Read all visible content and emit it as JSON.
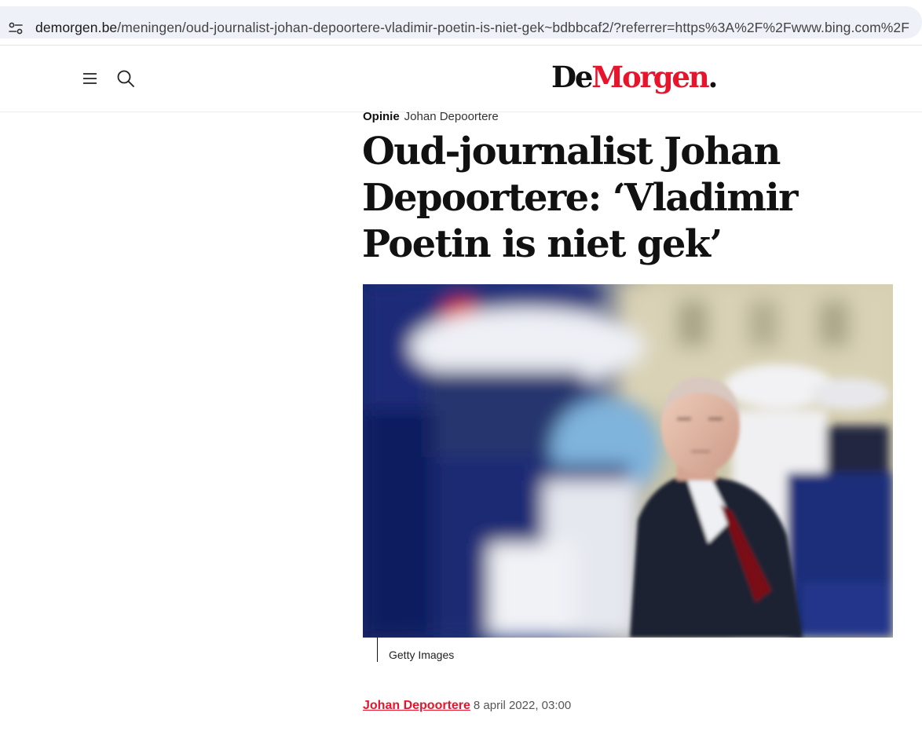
{
  "browser": {
    "url_host": "demorgen.be",
    "url_path": "/meningen/oud-journalist-johan-depoortere-vladimir-poetin-is-niet-gek~bdbbcaf2/?referrer=https%3A%2F%2Fwww.bing.com%2F",
    "site_info_icon": "tune-icon"
  },
  "header": {
    "menu_icon": "hamburger-menu-icon",
    "search_icon": "search-icon",
    "logo": {
      "part1": "De",
      "part2": "Morgen",
      "part3": "."
    },
    "colors": {
      "brand_red": "#e8142b"
    }
  },
  "article": {
    "section": "Opinie",
    "kicker_author": "Johan Depoortere",
    "headline": "Oud-journalist Johan Depoortere: ‘Vladimir Poetin is niet gek’",
    "image_caption": "Getty Images",
    "byline_author": "Johan Depoortere",
    "byline_date": "8 april 2022, 03:00"
  }
}
